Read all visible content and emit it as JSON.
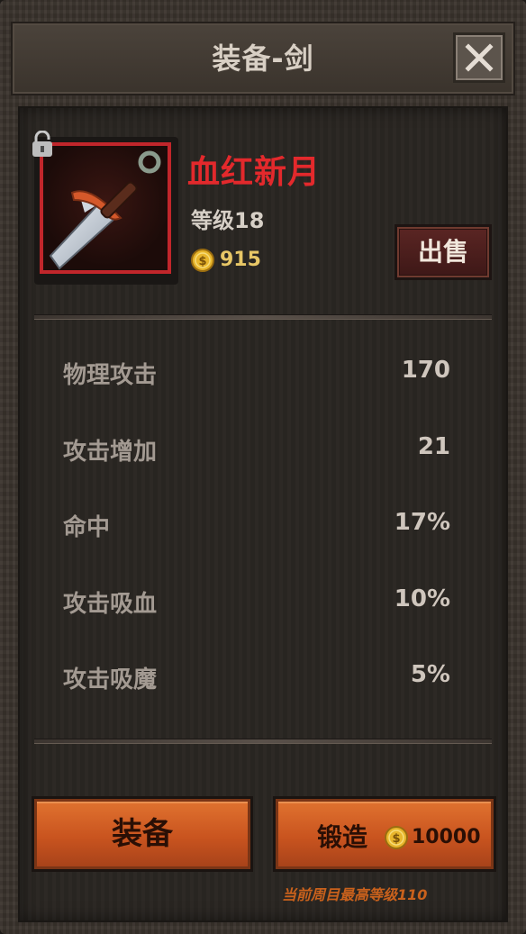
{
  "dialog": {
    "title": "装备-剑",
    "close_icon": "close-icon"
  },
  "item": {
    "name": "血红新月",
    "level": "等级18",
    "price": "915",
    "rarity_color": "#c1262b",
    "icon": "sword-icon",
    "locked": true
  },
  "actions": {
    "sell": "出售",
    "equip": "装备",
    "forge": "锻造",
    "forge_cost": "10000"
  },
  "stats": [
    {
      "label": "物理攻击",
      "value": "170"
    },
    {
      "label": "攻击增加",
      "value": "21"
    },
    {
      "label": "命中",
      "value": "17%"
    },
    {
      "label": "攻击吸血",
      "value": "10%"
    },
    {
      "label": "攻击吸魔",
      "value": "5%"
    }
  ],
  "footnote": "当前周目最高等级110",
  "colors": {
    "accent_red": "#e3292c",
    "gold": "#e8c766",
    "button_orange": "#c9541f"
  }
}
